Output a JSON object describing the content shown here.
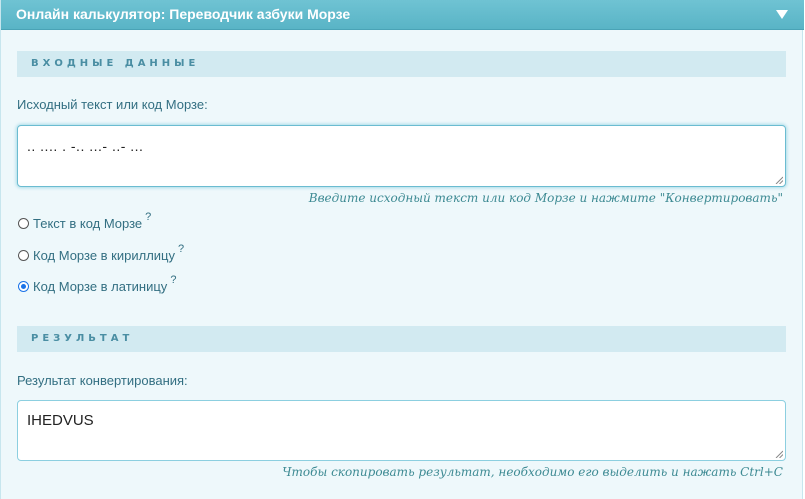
{
  "title": "Онлайн калькулятор: Переводчик азбуки Морзе",
  "input_section": {
    "header": "ВХОДНЫЕ ДАННЫЕ",
    "label": "Исходный текст или код Морзе:",
    "value": ".. .... . -.. ...- ..- ...",
    "hint": "Введите исходный текст или код Морзе и нажмите \"Конвертировать\""
  },
  "options": [
    {
      "label": "Текст в код Морзе",
      "help": "?",
      "checked": false
    },
    {
      "label": "Код Морзе в кириллицу",
      "help": "?",
      "checked": false
    },
    {
      "label": "Код Морзе в латиницу",
      "help": "?",
      "checked": true
    }
  ],
  "result_section": {
    "header": "РЕЗУЛЬТАТ",
    "label": "Результат конвертирования:",
    "value": "IHEDVUS",
    "hint": "Чтобы скопировать результат, необходимо его выделить и нажать Ctrl+C"
  },
  "colors": {
    "titlebar": "#5fb9ca",
    "panel_bg": "#eef8fb",
    "section_header_bg": "#d2eaf1",
    "label_text": "#336f82",
    "hint_text": "#3d8a93",
    "radio_accent": "#1a73e8"
  },
  "icons": {
    "collapse": "triangle-down-icon",
    "resize": "resize-grip-icon"
  }
}
